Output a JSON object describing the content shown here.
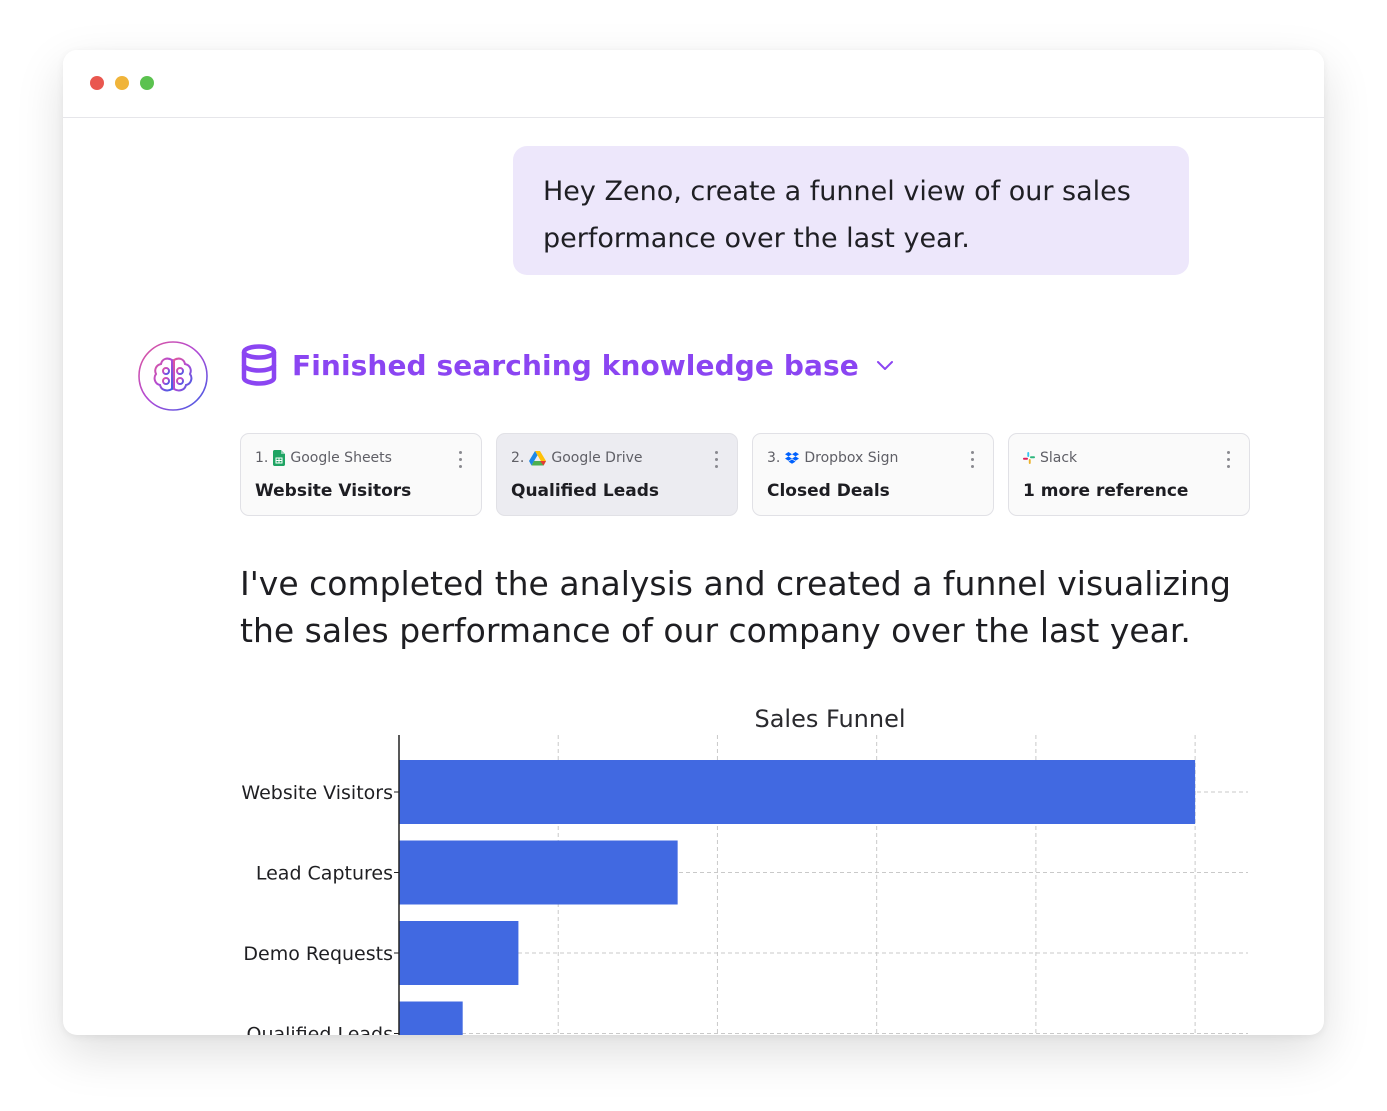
{
  "window": {
    "controls": [
      "close",
      "minimize",
      "maximize"
    ]
  },
  "conversation": {
    "user_message": "Hey Zeno, create a funnel view of our sales performance over the last year.",
    "assistant": {
      "avatar_icon": "brain-icon",
      "search_status": "Finished searching knowledge base",
      "status_color": "#8b45f2",
      "references": [
        {
          "index": "1.",
          "source": "Google Sheets",
          "source_icon": "google-sheets-icon",
          "title": "Website Visitors"
        },
        {
          "index": "2.",
          "source": "Google Drive",
          "source_icon": "google-drive-icon",
          "title": "Qualified Leads"
        },
        {
          "index": "3.",
          "source": "Dropbox Sign",
          "source_icon": "dropbox-icon",
          "title": "Closed Deals"
        },
        {
          "index": "",
          "source": "Slack",
          "source_icon": "slack-icon",
          "title": "1 more reference"
        }
      ],
      "answer_text": "I've completed the analysis and created a funnel visualizing the sales performance of our company over the last year."
    }
  },
  "chart_data": {
    "type": "bar",
    "orientation": "horizontal",
    "title": "Sales Funnel",
    "categories": [
      "Website Visitors",
      "Lead Captures",
      "Demo Requests",
      "Qualified Leads"
    ],
    "values": [
      10000,
      3500,
      1500,
      800
    ],
    "xlim": [
      0,
      10300
    ],
    "grid": true,
    "bar_color": "#4169e1"
  }
}
